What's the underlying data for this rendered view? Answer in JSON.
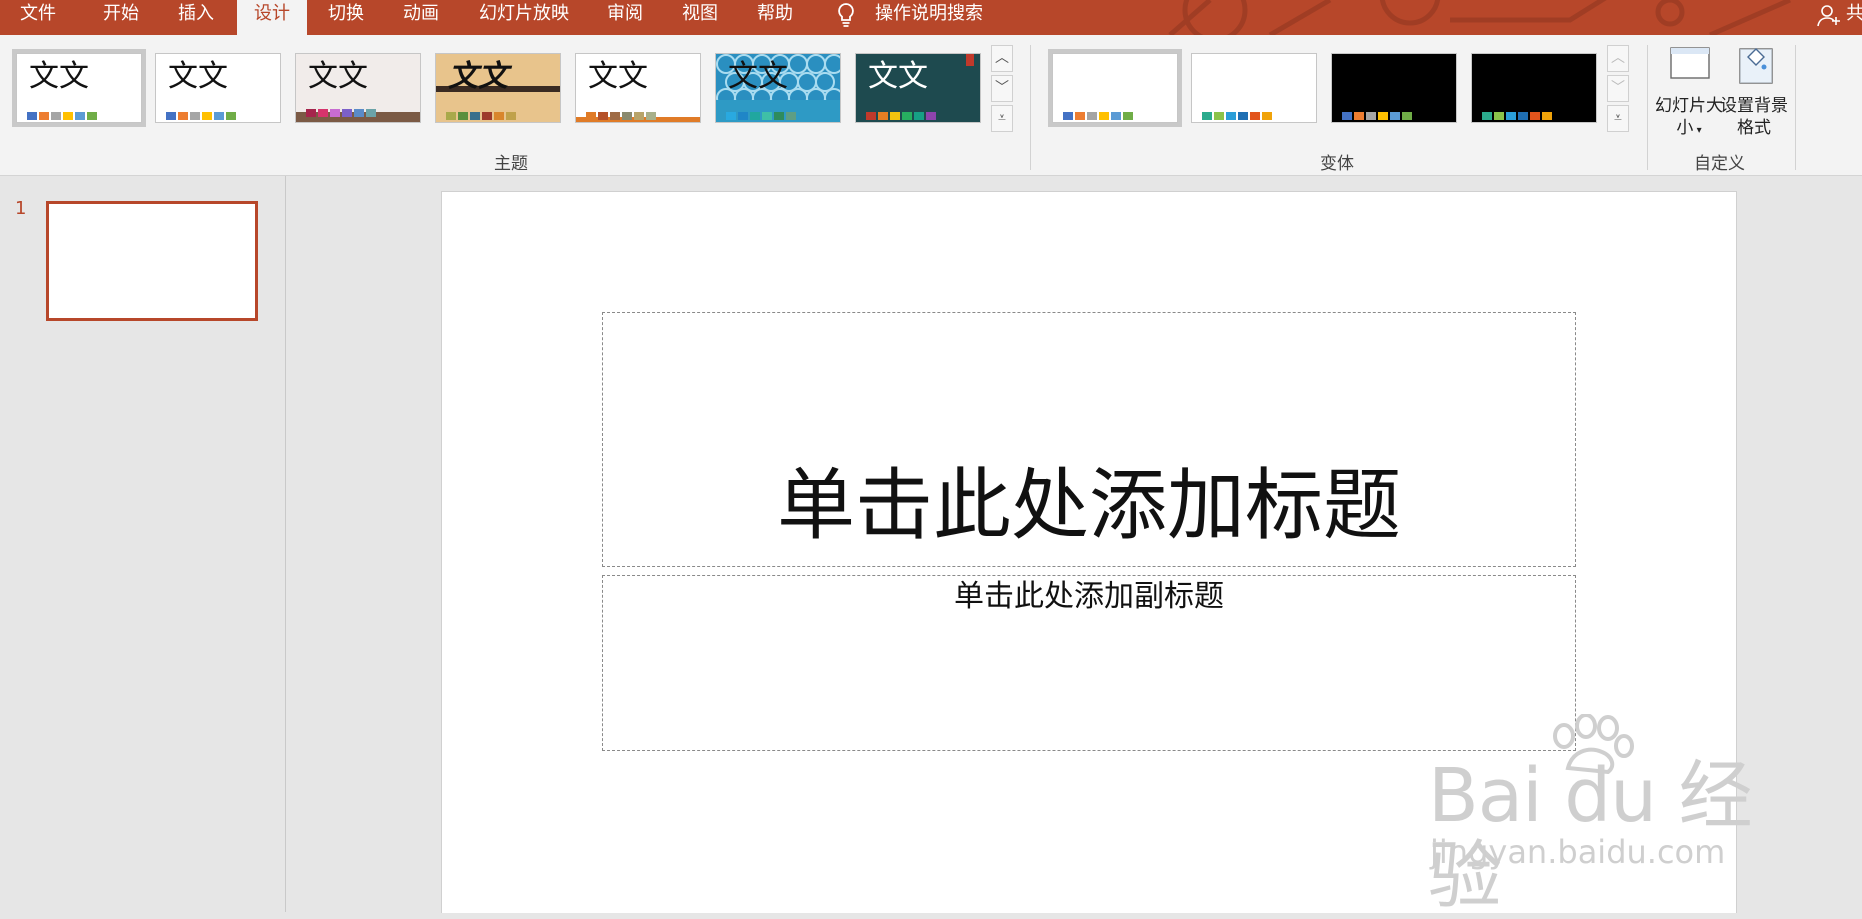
{
  "tabs": [
    {
      "label": "文件",
      "active": false
    },
    {
      "label": "开始",
      "active": false
    },
    {
      "label": "插入",
      "active": false
    },
    {
      "label": "设计",
      "active": true
    },
    {
      "label": "切换",
      "active": false
    },
    {
      "label": "动画",
      "active": false
    },
    {
      "label": "幻灯片放映",
      "active": false
    },
    {
      "label": "审阅",
      "active": false
    },
    {
      "label": "视图",
      "active": false
    },
    {
      "label": "帮助",
      "active": false
    }
  ],
  "tell_me": {
    "icon": "lightbulb-icon",
    "label": "操作说明搜索"
  },
  "share": {
    "icon": "person-add-icon",
    "label": "共"
  },
  "ribbon": {
    "themes_group_label": "主题",
    "variants_group_label": "变体",
    "customize_group_label": "自定义",
    "themes": [
      {
        "text": "文文",
        "bg": "#ffffff",
        "swatches": [
          "#4472c4",
          "#ed7d31",
          "#a5a5a5",
          "#ffc000",
          "#5b9bd5",
          "#70ad47"
        ]
      },
      {
        "text": "文文",
        "bg": "#ffffff",
        "swatches": [
          "#4472c4",
          "#ed7d31",
          "#a5a5a5",
          "#ffc000",
          "#5b9bd5",
          "#70ad47"
        ]
      },
      {
        "text": "文文",
        "bg": "#f1ecea",
        "swatches": [
          "#a5254c",
          "#d6336c",
          "#c86cd1",
          "#7c60c9",
          "#5a8bc8",
          "#6ba3a8"
        ]
      },
      {
        "text": "文文",
        "bg": "#e8c48c",
        "swatches": [
          "#a9a94a",
          "#5b8f3d",
          "#3a6f8c",
          "#9d3b2c",
          "#d9862c",
          "#c0a14a"
        ]
      },
      {
        "text": "文文",
        "bg": "#ffffff",
        "swatches": [
          "#e07b27",
          "#b5522a",
          "#9e6b45",
          "#8a8a6e",
          "#b8a46a",
          "#a8b08a"
        ]
      },
      {
        "text": "文文",
        "bg": "#2e9ac5",
        "swatches": [
          "#29a9e0",
          "#1f86c7",
          "#20a79f",
          "#3fbfa7",
          "#2e8c5d",
          "#5e9e85"
        ]
      },
      {
        "text": "文文",
        "bg": "#1e4a4f",
        "swatches": [
          "#c0392b",
          "#e67e22",
          "#f1c40f",
          "#27ae60",
          "#16a085",
          "#8e44ad"
        ]
      }
    ],
    "variants": [
      {
        "bg": "#ffffff",
        "swatches": [
          "#4472c4",
          "#ed7d31",
          "#a5a5a5",
          "#ffc000",
          "#5b9bd5",
          "#70ad47"
        ]
      },
      {
        "bg": "#ffffff",
        "swatches": [
          "#2bab8d",
          "#8bc34a",
          "#2b9ed8",
          "#1f6fb3",
          "#e2541c",
          "#f0a30a"
        ]
      },
      {
        "bg": "#000000",
        "swatches": [
          "#4472c4",
          "#ed7d31",
          "#a5a5a5",
          "#ffc000",
          "#5b9bd5",
          "#70ad47"
        ]
      },
      {
        "bg": "#000000",
        "swatches": [
          "#2bab8d",
          "#8bc34a",
          "#2b9ed8",
          "#1f6fb3",
          "#e2541c",
          "#f0a30a"
        ]
      }
    ],
    "slide_size_label": "幻灯片大小",
    "format_background_label": "设置背景格式"
  },
  "slides_pane": {
    "slide_number": "1"
  },
  "slide": {
    "title_placeholder": "单击此处添加标题",
    "subtitle_placeholder": "单击此处添加副标题"
  },
  "watermark": {
    "logo": "Bai du 经验",
    "url": "jingyan.baidu.com"
  },
  "colors": {
    "accent": "#b7472a",
    "ribbon_bg": "#f3f3f3",
    "pane_bg": "#e6e6e6"
  }
}
